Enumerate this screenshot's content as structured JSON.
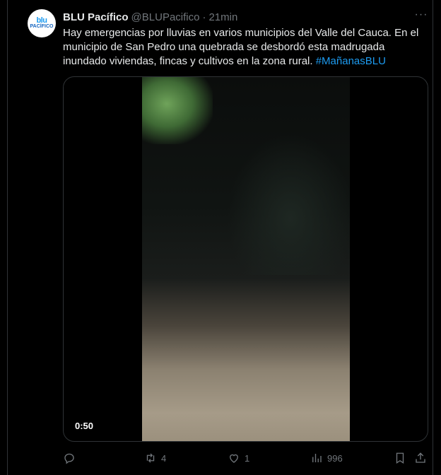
{
  "tweet": {
    "avatar_top": "blu",
    "avatar_bottom": "PACÍFICO",
    "name": "BLU Pacífico",
    "handle": "@BLUPacifico",
    "separator": "·",
    "time": "21min",
    "more": "···",
    "text": "Hay emergencias por lluvias en varios municipios del Valle del Cauca. En el municipio de San Pedro una quebrada se desbordó esta madrugada inundado viviendas, fincas y cultivos en la zona rural.",
    "hashtag": "#MañanasBLU",
    "colors": {
      "accent": "#1d9bf0",
      "muted": "#71767b",
      "text": "#e7e9ea"
    }
  },
  "media": {
    "duration": "0:50"
  },
  "actions": {
    "reply_icon": "reply-icon",
    "retweet_icon": "retweet-icon",
    "retweets": "4",
    "like_icon": "heart-icon",
    "likes": "1",
    "views_icon": "views-icon",
    "views": "996",
    "bookmark_icon": "bookmark-icon",
    "share_icon": "share-icon"
  }
}
